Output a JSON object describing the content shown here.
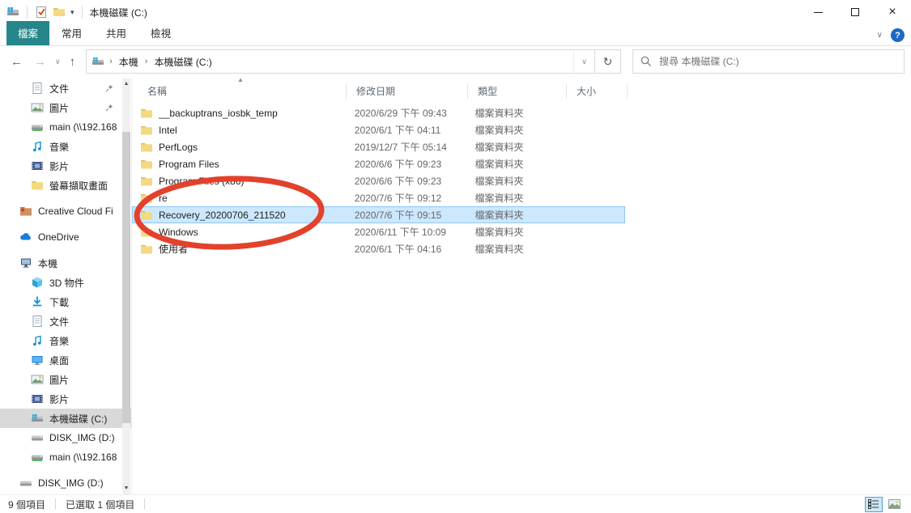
{
  "window": {
    "title": "本機磁碟 (C:)",
    "controls": {
      "minimize": "minimize",
      "maximize": "maximize",
      "close": "close"
    }
  },
  "quick_access_toolbar": {
    "icons": [
      "app-drive-icon",
      "properties-check-icon",
      "new-folder-icon"
    ],
    "customize_arrow": "▾"
  },
  "ribbon": {
    "tabs": [
      {
        "label": "檔案",
        "active": true
      },
      {
        "label": "常用",
        "active": false
      },
      {
        "label": "共用",
        "active": false
      },
      {
        "label": "檢視",
        "active": false
      }
    ],
    "collapse_chevron": "∨",
    "help_label": "?"
  },
  "navbar": {
    "back": "←",
    "forward": "→",
    "history_chevron": "∨",
    "up": "↑",
    "breadcrumb": [
      "本機",
      "本機磁碟 (C:)"
    ],
    "breadcrumb_separator": "›",
    "address_chevron": "∨",
    "refresh": "↻",
    "search_placeholder": "搜尋 本機磁碟 (C:)"
  },
  "sidebar": {
    "items": [
      {
        "label": "文件",
        "icon": "document-icon",
        "indent": 1,
        "pinned": true
      },
      {
        "label": "圖片",
        "icon": "picture-icon",
        "indent": 1,
        "pinned": true
      },
      {
        "label": "main (\\\\192.168",
        "icon": "network-drive-icon",
        "indent": 1
      },
      {
        "label": "音樂",
        "icon": "music-icon",
        "indent": 1
      },
      {
        "label": "影片",
        "icon": "video-icon",
        "indent": 1
      },
      {
        "label": "螢幕擷取畫面",
        "icon": "folder-icon",
        "indent": 1
      },
      {
        "label": "Creative Cloud Fi",
        "icon": "creative-cloud-icon",
        "indent": 0,
        "gap": true
      },
      {
        "label": "OneDrive",
        "icon": "onedrive-icon",
        "indent": 0,
        "gap": true
      },
      {
        "label": "本機",
        "icon": "computer-icon",
        "indent": 0,
        "gap": true
      },
      {
        "label": "3D 物件",
        "icon": "cube-icon",
        "indent": 1
      },
      {
        "label": "下載",
        "icon": "download-icon",
        "indent": 1
      },
      {
        "label": "文件",
        "icon": "document-icon",
        "indent": 1
      },
      {
        "label": "音樂",
        "icon": "music-icon",
        "indent": 1
      },
      {
        "label": "桌面",
        "icon": "desktop-icon",
        "indent": 1
      },
      {
        "label": "圖片",
        "icon": "picture-icon",
        "indent": 1
      },
      {
        "label": "影片",
        "icon": "video-icon",
        "indent": 1
      },
      {
        "label": "本機磁碟 (C:)",
        "icon": "drive-c-icon",
        "indent": 1,
        "selected": true
      },
      {
        "label": "DISK_IMG (D:)",
        "icon": "drive-icon",
        "indent": 1
      },
      {
        "label": "main (\\\\192.168",
        "icon": "network-drive-icon",
        "indent": 1
      },
      {
        "label": "DISK_IMG (D:)",
        "icon": "drive-icon",
        "indent": 0,
        "gap": true
      }
    ]
  },
  "filelist": {
    "columns": [
      {
        "key": "name",
        "label": "名稱",
        "sorted": "asc"
      },
      {
        "key": "date",
        "label": "修改日期"
      },
      {
        "key": "type",
        "label": "類型"
      },
      {
        "key": "size",
        "label": "大小"
      }
    ],
    "rows": [
      {
        "name": "__backuptrans_iosbk_temp",
        "date": "2020/6/29 下午 09:43",
        "type": "檔案資料夾",
        "size": "",
        "selected": false
      },
      {
        "name": "Intel",
        "date": "2020/6/1 下午 04:11",
        "type": "檔案資料夾",
        "size": "",
        "selected": false
      },
      {
        "name": "PerfLogs",
        "date": "2019/12/7 下午 05:14",
        "type": "檔案資料夾",
        "size": "",
        "selected": false
      },
      {
        "name": "Program Files",
        "date": "2020/6/6 下午 09:23",
        "type": "檔案資料夾",
        "size": "",
        "selected": false
      },
      {
        "name": "Program Files (x86)",
        "date": "2020/6/6 下午 09:23",
        "type": "檔案資料夾",
        "size": "",
        "selected": false
      },
      {
        "name": "re",
        "date": "2020/7/6 下午 09:12",
        "type": "檔案資料夾",
        "size": "",
        "selected": false
      },
      {
        "name": "Recovery_20200706_211520",
        "date": "2020/7/6 下午 09:15",
        "type": "檔案資料夾",
        "size": "",
        "selected": true
      },
      {
        "name": "Windows",
        "date": "2020/6/11 下午 10:09",
        "type": "檔案資料夾",
        "size": "",
        "selected": false
      },
      {
        "name": "使用者",
        "date": "2020/6/1 下午 04:16",
        "type": "檔案資料夾",
        "size": "",
        "selected": false
      }
    ]
  },
  "annotation": {
    "shape": "ellipse",
    "color": "#e3412c",
    "circled_rows": [
      "re",
      "Recovery_20200706_211520",
      "Windows"
    ]
  },
  "statusbar": {
    "item_count": "9 個項目",
    "selected_count": "已選取 1 個項目"
  },
  "colors": {
    "accent_tab": "#25868c",
    "selection_fill": "#cce8ff",
    "selection_border": "#8fc6f2",
    "sidebar_selected": "#d9d9d9",
    "annotation_red": "#e3412c",
    "folder_yellow": "#f3d982"
  }
}
